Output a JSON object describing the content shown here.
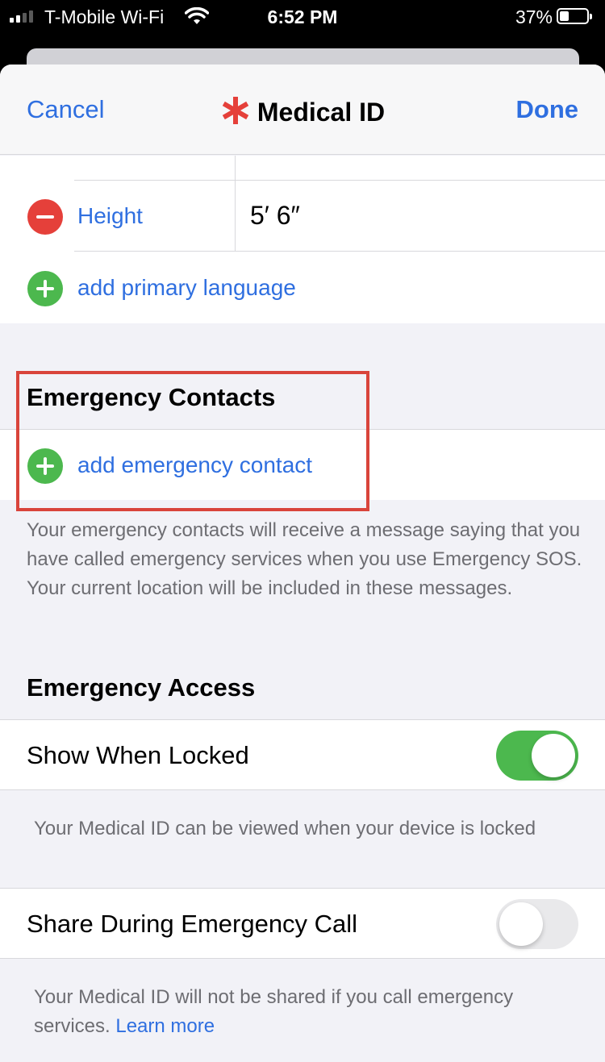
{
  "status_bar": {
    "carrier": "T-Mobile Wi-Fi",
    "time": "6:52 PM",
    "battery": "37%",
    "battery_level": 0.37
  },
  "navbar": {
    "cancel": "Cancel",
    "title": "Medical ID",
    "done": "Done",
    "title_icon": "medical-star-icon",
    "title_icon_color": "#e5403a"
  },
  "health_fields": {
    "height_label": "Height",
    "height_value": "5′ 6″",
    "add_language": "add primary language"
  },
  "emergency_contacts": {
    "header": "Emergency Contacts",
    "add_contact": "add emergency contact",
    "footer": "Your emergency contacts will receive a message saying that you have called emergency services when you use Emergency SOS. Your current location will be included in these messages."
  },
  "emergency_access": {
    "header": "Emergency Access",
    "show_when_locked": {
      "label": "Show When Locked",
      "on": true,
      "footer": "Your Medical ID can be viewed when your device is locked"
    },
    "share_during_call": {
      "label": "Share During Emergency Call",
      "on": false,
      "footer": "Your Medical ID will not be shared if you call emergency services.",
      "learn_more": "Learn more"
    }
  },
  "colors": {
    "accent": "#2f6fe0",
    "add_green": "#4cb84e",
    "remove_red": "#e5403a",
    "highlight": "#d9443b"
  }
}
